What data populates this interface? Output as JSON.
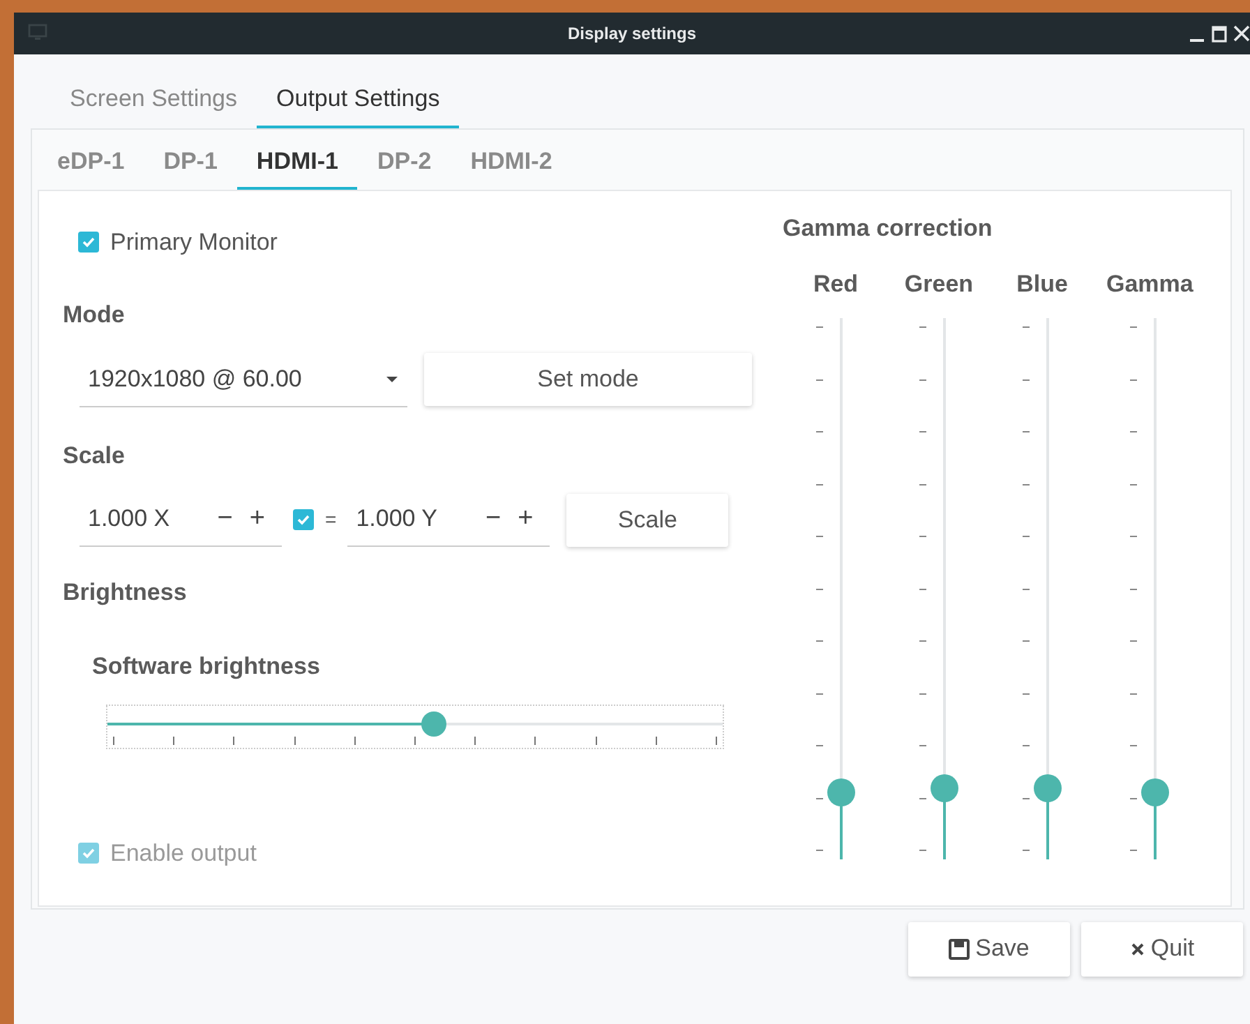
{
  "window": {
    "title": "Display settings"
  },
  "tabs": [
    {
      "label": "Screen Settings",
      "selected": false
    },
    {
      "label": "Output Settings",
      "selected": true
    }
  ],
  "outputs": [
    {
      "label": "eDP-1",
      "selected": false
    },
    {
      "label": "DP-1",
      "selected": false
    },
    {
      "label": "HDMI-1",
      "selected": true
    },
    {
      "label": "DP-2",
      "selected": false
    },
    {
      "label": "HDMI-2",
      "selected": false
    }
  ],
  "primary_monitor": {
    "label": "Primary Monitor",
    "checked": true
  },
  "mode": {
    "heading": "Mode",
    "value": "1920x1080 @ 60.00",
    "button": "Set mode"
  },
  "scale": {
    "heading": "Scale",
    "x_value": "1.000 X",
    "x_steppers": [
      "−",
      "+"
    ],
    "linked": true,
    "equals": "=",
    "y_value": "1.000 Y",
    "y_steppers": [
      "−",
      "+"
    ],
    "button": "Scale"
  },
  "brightness": {
    "heading": "Brightness",
    "label": "Software brightness",
    "level": 0.53
  },
  "enable_output": {
    "label": "Enable output",
    "checked": true,
    "disabled": true
  },
  "gamma": {
    "heading": "Gamma correction",
    "channels": [
      {
        "name": "Red",
        "level": 0.1
      },
      {
        "name": "Green",
        "level": 0.11
      },
      {
        "name": "Blue",
        "level": 0.11
      },
      {
        "name": "Gamma",
        "level": 0.1
      }
    ]
  },
  "buttons": [
    {
      "label": "Save",
      "kind": "save"
    },
    {
      "label": "Quit",
      "kind": "quit"
    }
  ]
}
